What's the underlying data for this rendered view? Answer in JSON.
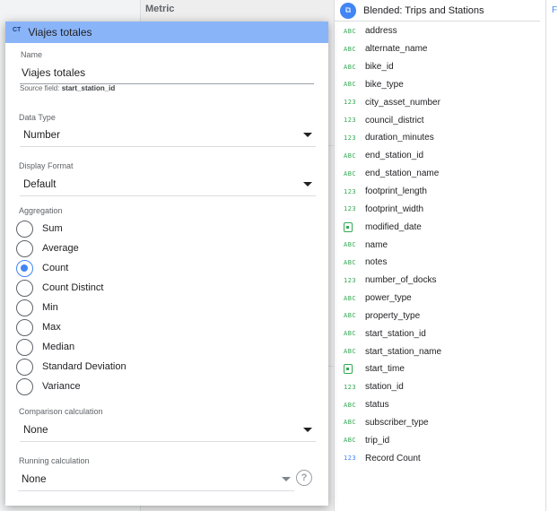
{
  "background": {
    "metric_label": "Metric"
  },
  "data_source": {
    "name": "Blended: Trips and Stations",
    "fields": [
      {
        "type": "ABC",
        "name": "address"
      },
      {
        "type": "ABC",
        "name": "alternate_name"
      },
      {
        "type": "ABC",
        "name": "bike_id"
      },
      {
        "type": "ABC",
        "name": "bike_type"
      },
      {
        "type": "123",
        "name": "city_asset_number"
      },
      {
        "type": "123",
        "name": "council_district"
      },
      {
        "type": "123",
        "name": "duration_minutes"
      },
      {
        "type": "ABC",
        "name": "end_station_id"
      },
      {
        "type": "ABC",
        "name": "end_station_name"
      },
      {
        "type": "123",
        "name": "footprint_length"
      },
      {
        "type": "123",
        "name": "footprint_width"
      },
      {
        "type": "date",
        "name": "modified_date"
      },
      {
        "type": "ABC",
        "name": "name"
      },
      {
        "type": "ABC",
        "name": "notes"
      },
      {
        "type": "123",
        "name": "number_of_docks"
      },
      {
        "type": "ABC",
        "name": "power_type"
      },
      {
        "type": "ABC",
        "name": "property_type"
      },
      {
        "type": "ABC",
        "name": "start_station_id"
      },
      {
        "type": "ABC",
        "name": "start_station_name"
      },
      {
        "type": "date",
        "name": "start_time"
      },
      {
        "type": "123",
        "name": "station_id"
      },
      {
        "type": "ABC",
        "name": "status"
      },
      {
        "type": "ABC",
        "name": "subscriber_type"
      },
      {
        "type": "ABC",
        "name": "trip_id"
      },
      {
        "type": "123",
        "name": "Record Count",
        "accent": true
      }
    ]
  },
  "dialog": {
    "header_badge": "CT",
    "title": "Viajes totales",
    "name_label": "Name",
    "name_value": "Viajes totales",
    "source_field_label": "Source field:",
    "source_field_value": "start_station_id",
    "data_type_label": "Data Type",
    "data_type_value": "Number",
    "display_format_label": "Display Format",
    "display_format_value": "Default",
    "aggregation_label": "Aggregation",
    "aggregation_options": [
      "Sum",
      "Average",
      "Count",
      "Count Distinct",
      "Min",
      "Max",
      "Median",
      "Standard Deviation",
      "Variance"
    ],
    "aggregation_selected": "Count",
    "comparison_label": "Comparison calculation",
    "comparison_value": "None",
    "running_label": "Running calculation",
    "running_value": "None",
    "help_glyph": "?"
  },
  "right_strip": {
    "letter": "F"
  },
  "colors": {
    "accent": "#4285f4",
    "header": "#8ab4f8",
    "type_green": "#34a853"
  }
}
